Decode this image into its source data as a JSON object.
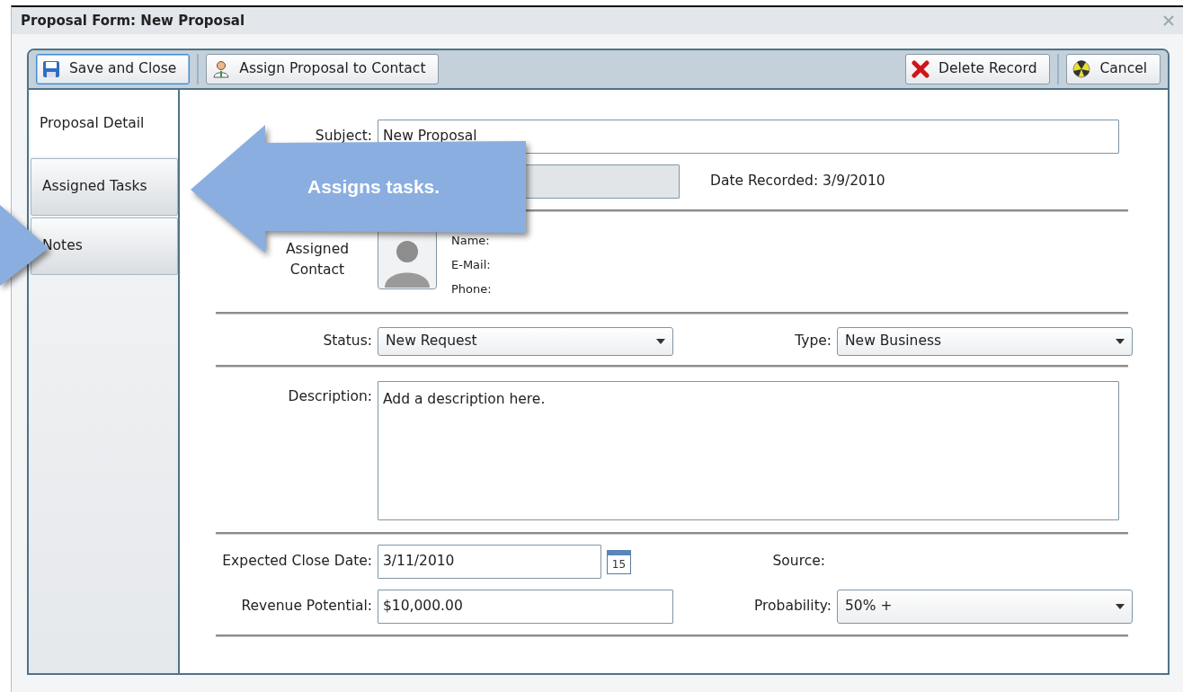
{
  "window": {
    "title": "Proposal Form: New Proposal"
  },
  "toolbar_left": [
    {
      "label": "Save and Close",
      "kind": "save",
      "focused": true
    },
    {
      "label": "Assign Proposal to Contact",
      "kind": "assign",
      "focused": false
    }
  ],
  "toolbar_right": [
    {
      "label": "Delete Record",
      "kind": "delete",
      "focused": false
    },
    {
      "label": "Cancel",
      "kind": "cancel",
      "focused": false
    }
  ],
  "tabs": [
    {
      "label": "Proposal Detail",
      "selected": true
    },
    {
      "label": "Assigned Tasks",
      "selected": false
    },
    {
      "label": "Notes",
      "selected": false
    }
  ],
  "form": {
    "subject": {
      "label": "Subject:",
      "value": "New Proposal"
    },
    "field_2": {
      "disabled": true
    },
    "date_recorded": "Date Recorded: 3/9/2010",
    "assigned_contact": {
      "label": "Assigned Contact",
      "fields": [
        "Name:",
        "E-Mail:",
        "Phone:"
      ]
    },
    "status": {
      "label": "Status:",
      "value": "New Request"
    },
    "type": {
      "label": "Type:",
      "value": "New Business"
    },
    "description": {
      "label": "Description:",
      "value": "Add a description here."
    },
    "expected_close_date": {
      "label": "Expected Close Date:",
      "value": "3/11/2010",
      "calendar_day": "15"
    },
    "source": {
      "label": "Source:"
    },
    "revenue_potential": {
      "label": "Revenue Potential:",
      "value": "$10,000.00"
    },
    "probability": {
      "label": "Probability:",
      "value": "50% +"
    }
  },
  "callout": {
    "text": "Assigns tasks."
  }
}
